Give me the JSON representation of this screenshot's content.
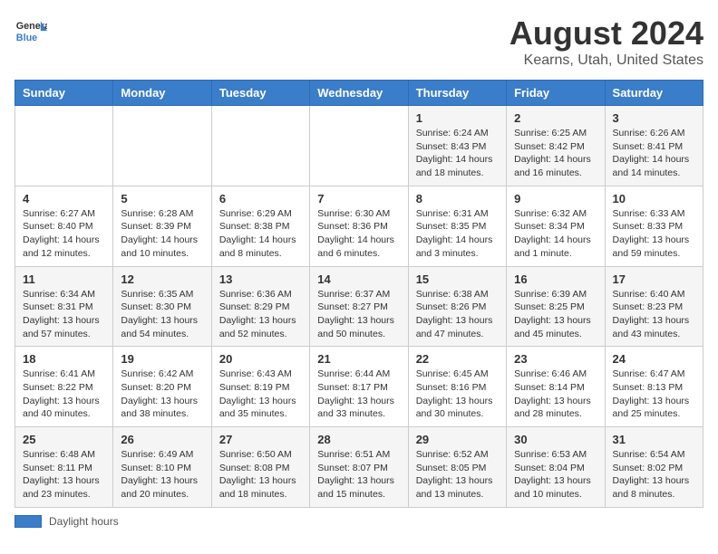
{
  "header": {
    "logo_general": "General",
    "logo_blue": "Blue",
    "main_title": "August 2024",
    "sub_title": "Kearns, Utah, United States"
  },
  "legend": {
    "label": "Daylight hours"
  },
  "columns": [
    "Sunday",
    "Monday",
    "Tuesday",
    "Wednesday",
    "Thursday",
    "Friday",
    "Saturday"
  ],
  "weeks": [
    [
      {
        "day": "",
        "info": ""
      },
      {
        "day": "",
        "info": ""
      },
      {
        "day": "",
        "info": ""
      },
      {
        "day": "",
        "info": ""
      },
      {
        "day": "1",
        "info": "Sunrise: 6:24 AM\nSunset: 8:43 PM\nDaylight: 14 hours\nand 18 minutes."
      },
      {
        "day": "2",
        "info": "Sunrise: 6:25 AM\nSunset: 8:42 PM\nDaylight: 14 hours\nand 16 minutes."
      },
      {
        "day": "3",
        "info": "Sunrise: 6:26 AM\nSunset: 8:41 PM\nDaylight: 14 hours\nand 14 minutes."
      }
    ],
    [
      {
        "day": "4",
        "info": "Sunrise: 6:27 AM\nSunset: 8:40 PM\nDaylight: 14 hours\nand 12 minutes."
      },
      {
        "day": "5",
        "info": "Sunrise: 6:28 AM\nSunset: 8:39 PM\nDaylight: 14 hours\nand 10 minutes."
      },
      {
        "day": "6",
        "info": "Sunrise: 6:29 AM\nSunset: 8:38 PM\nDaylight: 14 hours\nand 8 minutes."
      },
      {
        "day": "7",
        "info": "Sunrise: 6:30 AM\nSunset: 8:36 PM\nDaylight: 14 hours\nand 6 minutes."
      },
      {
        "day": "8",
        "info": "Sunrise: 6:31 AM\nSunset: 8:35 PM\nDaylight: 14 hours\nand 3 minutes."
      },
      {
        "day": "9",
        "info": "Sunrise: 6:32 AM\nSunset: 8:34 PM\nDaylight: 14 hours\nand 1 minute."
      },
      {
        "day": "10",
        "info": "Sunrise: 6:33 AM\nSunset: 8:33 PM\nDaylight: 13 hours\nand 59 minutes."
      }
    ],
    [
      {
        "day": "11",
        "info": "Sunrise: 6:34 AM\nSunset: 8:31 PM\nDaylight: 13 hours\nand 57 minutes."
      },
      {
        "day": "12",
        "info": "Sunrise: 6:35 AM\nSunset: 8:30 PM\nDaylight: 13 hours\nand 54 minutes."
      },
      {
        "day": "13",
        "info": "Sunrise: 6:36 AM\nSunset: 8:29 PM\nDaylight: 13 hours\nand 52 minutes."
      },
      {
        "day": "14",
        "info": "Sunrise: 6:37 AM\nSunset: 8:27 PM\nDaylight: 13 hours\nand 50 minutes."
      },
      {
        "day": "15",
        "info": "Sunrise: 6:38 AM\nSunset: 8:26 PM\nDaylight: 13 hours\nand 47 minutes."
      },
      {
        "day": "16",
        "info": "Sunrise: 6:39 AM\nSunset: 8:25 PM\nDaylight: 13 hours\nand 45 minutes."
      },
      {
        "day": "17",
        "info": "Sunrise: 6:40 AM\nSunset: 8:23 PM\nDaylight: 13 hours\nand 43 minutes."
      }
    ],
    [
      {
        "day": "18",
        "info": "Sunrise: 6:41 AM\nSunset: 8:22 PM\nDaylight: 13 hours\nand 40 minutes."
      },
      {
        "day": "19",
        "info": "Sunrise: 6:42 AM\nSunset: 8:20 PM\nDaylight: 13 hours\nand 38 minutes."
      },
      {
        "day": "20",
        "info": "Sunrise: 6:43 AM\nSunset: 8:19 PM\nDaylight: 13 hours\nand 35 minutes."
      },
      {
        "day": "21",
        "info": "Sunrise: 6:44 AM\nSunset: 8:17 PM\nDaylight: 13 hours\nand 33 minutes."
      },
      {
        "day": "22",
        "info": "Sunrise: 6:45 AM\nSunset: 8:16 PM\nDaylight: 13 hours\nand 30 minutes."
      },
      {
        "day": "23",
        "info": "Sunrise: 6:46 AM\nSunset: 8:14 PM\nDaylight: 13 hours\nand 28 minutes."
      },
      {
        "day": "24",
        "info": "Sunrise: 6:47 AM\nSunset: 8:13 PM\nDaylight: 13 hours\nand 25 minutes."
      }
    ],
    [
      {
        "day": "25",
        "info": "Sunrise: 6:48 AM\nSunset: 8:11 PM\nDaylight: 13 hours\nand 23 minutes."
      },
      {
        "day": "26",
        "info": "Sunrise: 6:49 AM\nSunset: 8:10 PM\nDaylight: 13 hours\nand 20 minutes."
      },
      {
        "day": "27",
        "info": "Sunrise: 6:50 AM\nSunset: 8:08 PM\nDaylight: 13 hours\nand 18 minutes."
      },
      {
        "day": "28",
        "info": "Sunrise: 6:51 AM\nSunset: 8:07 PM\nDaylight: 13 hours\nand 15 minutes."
      },
      {
        "day": "29",
        "info": "Sunrise: 6:52 AM\nSunset: 8:05 PM\nDaylight: 13 hours\nand 13 minutes."
      },
      {
        "day": "30",
        "info": "Sunrise: 6:53 AM\nSunset: 8:04 PM\nDaylight: 13 hours\nand 10 minutes."
      },
      {
        "day": "31",
        "info": "Sunrise: 6:54 AM\nSunset: 8:02 PM\nDaylight: 13 hours\nand 8 minutes."
      }
    ]
  ]
}
